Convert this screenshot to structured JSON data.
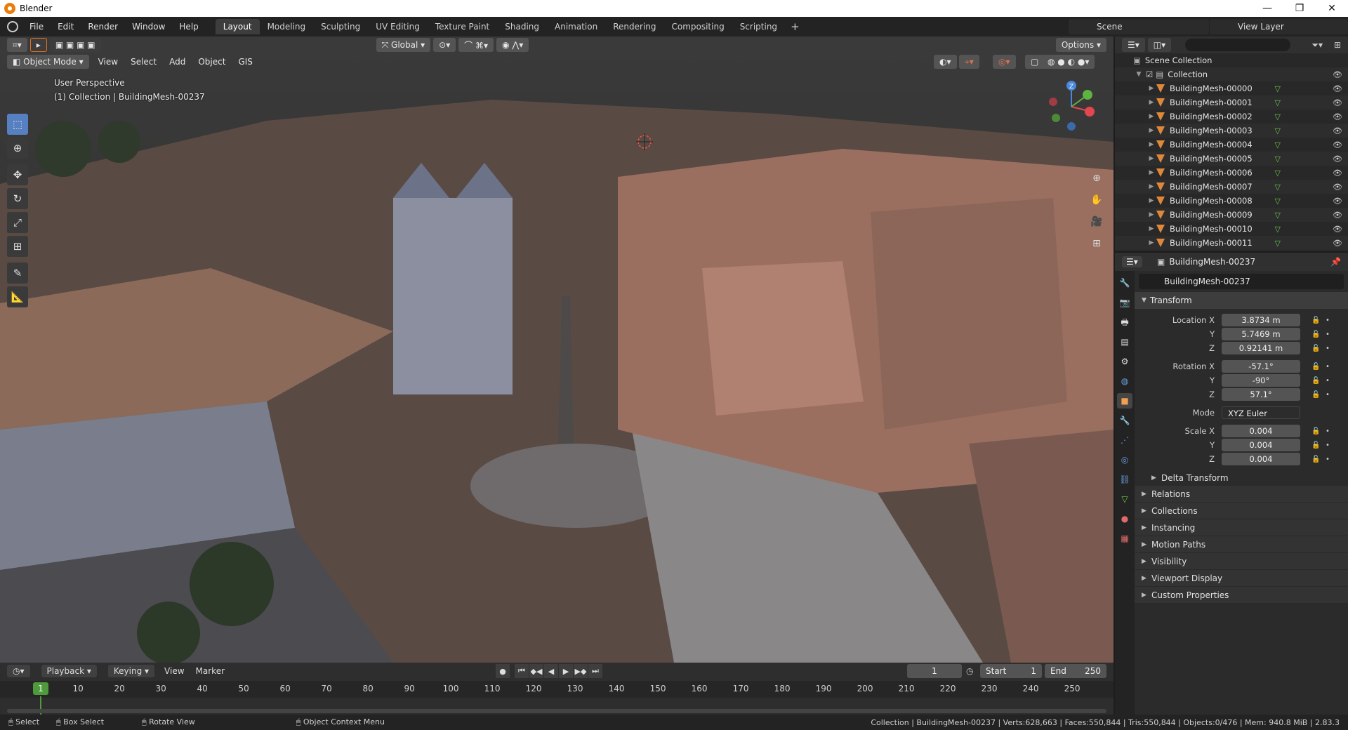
{
  "window": {
    "title": "Blender",
    "min": "—",
    "max": "❐",
    "close": "✕"
  },
  "menu": [
    "File",
    "Edit",
    "Render",
    "Window",
    "Help"
  ],
  "workspace_tabs": [
    {
      "label": "Layout",
      "active": true
    },
    {
      "label": "Modeling"
    },
    {
      "label": "Sculpting"
    },
    {
      "label": "UV Editing"
    },
    {
      "label": "Texture Paint"
    },
    {
      "label": "Shading"
    },
    {
      "label": "Animation"
    },
    {
      "label": "Rendering"
    },
    {
      "label": "Compositing"
    },
    {
      "label": "Scripting"
    }
  ],
  "scene": "Scene",
  "view_layer": "View Layer",
  "viewport": {
    "transform_orientation": "Global",
    "options_label": "Options",
    "mode": "Object Mode",
    "menu": [
      "View",
      "Select",
      "Add",
      "Object",
      "GIS"
    ],
    "perspective": "User Perspective",
    "collection_info": "(1) Collection | BuildingMesh-00237"
  },
  "gizmo": {
    "x": "X",
    "y": "Y",
    "z": "Z"
  },
  "outliner": {
    "root": "Scene Collection",
    "collection": "Collection",
    "items": [
      "BuildingMesh-00000",
      "BuildingMesh-00001",
      "BuildingMesh-00002",
      "BuildingMesh-00003",
      "BuildingMesh-00004",
      "BuildingMesh-00005",
      "BuildingMesh-00006",
      "BuildingMesh-00007",
      "BuildingMesh-00008",
      "BuildingMesh-00009",
      "BuildingMesh-00010",
      "BuildingMesh-00011"
    ]
  },
  "properties": {
    "header_object": "BuildingMesh-00237",
    "object_name": "BuildingMesh-00237",
    "transform_label": "Transform",
    "location_x_label": "Location X",
    "location_x": "3.8734 m",
    "location_y_label": "Y",
    "location_y": "5.7469 m",
    "location_z_label": "Z",
    "location_z": "0.92141 m",
    "rotation_x_label": "Rotation X",
    "rotation_x": "-57.1°",
    "rotation_y_label": "Y",
    "rotation_y": "-90°",
    "rotation_z_label": "Z",
    "rotation_z": "57.1°",
    "mode_label": "Mode",
    "mode": "XYZ Euler",
    "scale_x_label": "Scale X",
    "scale_x": "0.004",
    "scale_y_label": "Y",
    "scale_y": "0.004",
    "scale_z_label": "Z",
    "scale_z": "0.004",
    "delta_transform": "Delta Transform",
    "panels": [
      "Relations",
      "Collections",
      "Instancing",
      "Motion Paths",
      "Visibility",
      "Viewport Display",
      "Custom Properties"
    ]
  },
  "timeline": {
    "playback": "Playback",
    "keying": "Keying",
    "view": "View",
    "marker": "Marker",
    "current_frame": "1",
    "start_label": "Start",
    "start": "1",
    "end_label": "End",
    "end": "250",
    "ticks": [
      "1",
      "10",
      "20",
      "30",
      "40",
      "50",
      "60",
      "70",
      "80",
      "90",
      "100",
      "110",
      "120",
      "130",
      "140",
      "150",
      "160",
      "170",
      "180",
      "190",
      "200",
      "210",
      "220",
      "230",
      "240",
      "250"
    ]
  },
  "status": {
    "select": "Select",
    "box_select": "Box Select",
    "rotate_view": "Rotate View",
    "context_menu": "Object Context Menu",
    "stats": "Collection | BuildingMesh-00237 | Verts:628,663 | Faces:550,844 | Tris:550,844 | Objects:0/476 | Mem: 940.8 MiB | 2.83.3"
  },
  "colors": {
    "accent": "#5680c2",
    "active_frame": "#4f9a3c",
    "mesh_icon": "#e0883a",
    "axis_x": "#e2474f",
    "axis_y": "#5fb340",
    "axis_z": "#4a88db"
  }
}
